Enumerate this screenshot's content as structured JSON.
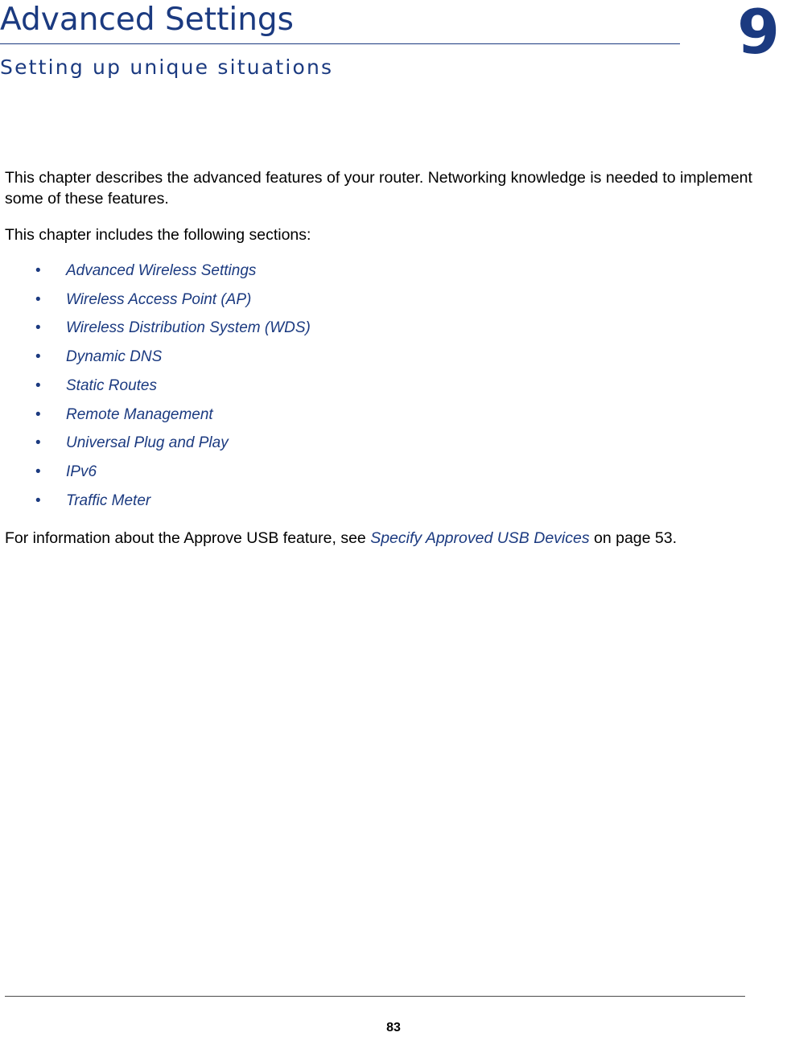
{
  "document": {
    "chapter_number": "9",
    "chapter_title": "Advanced Settings",
    "chapter_subtitle": "Setting up unique situations",
    "intro_paragraph": "This chapter describes the advanced features of your router. Networking knowledge is needed to implement some of these features.",
    "sections_lead_in": "This chapter includes the following sections:",
    "section_links": [
      {
        "bullet": "•",
        "label": "Advanced Wireless Settings"
      },
      {
        "bullet": "•",
        "label": "Wireless Access Point (AP)"
      },
      {
        "bullet": "•",
        "label": "Wireless Distribution System (WDS)"
      },
      {
        "bullet": "•",
        "label": "Dynamic DNS"
      },
      {
        "bullet": "•",
        "label": "Static Routes"
      },
      {
        "bullet": "•",
        "label": "Remote Management"
      },
      {
        "bullet": "•",
        "label": "Universal Plug and Play"
      },
      {
        "bullet": "•",
        "label": "IPv6"
      },
      {
        "bullet": "•",
        "label": "Traffic Meter"
      }
    ],
    "closing_note": {
      "before_link": "For information about the Approve USB feature, see ",
      "link_text": "Specify Approved USB Devices",
      "after_link": " on page 53."
    },
    "footer": {
      "page_number": "83"
    },
    "colors": {
      "accent": "#1b3a80",
      "text": "#000000",
      "rule": "#4a4a4a"
    }
  }
}
